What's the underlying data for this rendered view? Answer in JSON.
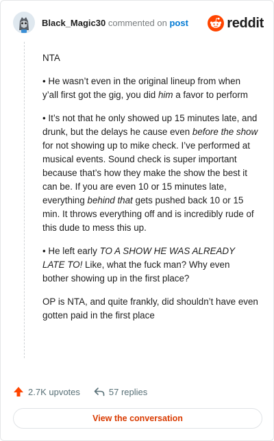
{
  "header": {
    "username": "Black_Magic30",
    "commented_text": "commented on",
    "post_link": "post",
    "brand": "reddit"
  },
  "comment": {
    "p1": "NTA",
    "p2": {
      "a": "• He wasn’t even in the original lineup from when y’all first got the gig, you did ",
      "b": "him",
      "c": " a favor to perform"
    },
    "p3": {
      "a": "• It’s not that he only showed up 15 minutes late, and drunk, but the delays he cause even ",
      "b": "before the show",
      "c": " for not showing up to mike check. I’ve performed at musical events. Sound check is super important because that’s how they make the show the best it can be. If you are even 10 or 15 minutes late, everything ",
      "d": "behind that",
      "e": " gets pushed back 10 or 15 min. It throws everything off and is incredibly rude of this dude to mess this up."
    },
    "p4": {
      "a": "• He left early ",
      "b": "TO A SHOW HE WAS ALREADY LATE TO!",
      "c": " Like, what the fuck man? Why even bother showing up in the first place?"
    },
    "p5": "OP is NTA, and quite frankly, did shouldn’t have even gotten paid in the first place"
  },
  "actions": {
    "upvotes": "2.7K upvotes",
    "replies": "57 replies"
  },
  "view_button": "View the conversation",
  "colors": {
    "reddit_orange": "#ff4500",
    "link_blue": "#0079d3",
    "button_text": "#d93a00"
  },
  "icons": {
    "avatar": "avatar-icon",
    "brand": "reddit-logo-icon",
    "upvote": "upvote-arrow-icon",
    "reply": "reply-arrow-icon"
  }
}
